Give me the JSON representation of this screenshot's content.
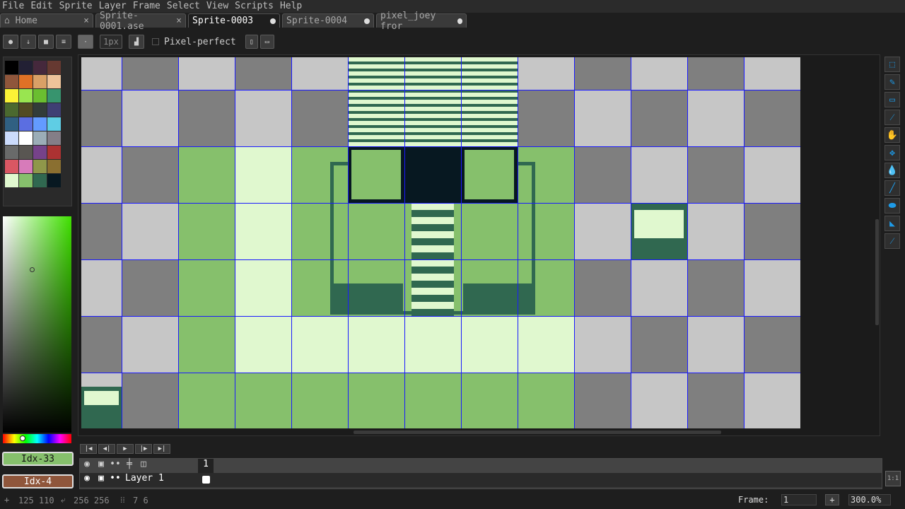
{
  "menu": [
    "File",
    "Edit",
    "Sprite",
    "Layer",
    "Frame",
    "Select",
    "View",
    "Scripts",
    "Help"
  ],
  "tabs": [
    {
      "label": "Home",
      "icon": "home-icon",
      "close": "×"
    },
    {
      "label": "Sprite-0001.ase",
      "close": "×"
    },
    {
      "label": "Sprite-0003",
      "active": true,
      "modified": true
    },
    {
      "label": "Sprite-0004",
      "modified": true
    },
    {
      "label": "pixel_joey fror",
      "modified": true
    }
  ],
  "toolbar": {
    "brush_size": "1px",
    "pixel_perfect_label": "Pixel-perfect",
    "pixel_perfect_checked": false
  },
  "palette": [
    "#000000",
    "#222034",
    "#45283c",
    "#663931",
    "#8f563b",
    "#df7126",
    "#d9a066",
    "#eec39a",
    "#fbf236",
    "#99e550",
    "#6abe30",
    "#37946e",
    "#4b692f",
    "#524b24",
    "#323c39",
    "#3f3f74",
    "#306082",
    "#5b6ee1",
    "#639bff",
    "#5fcde4",
    "#cbdbfc",
    "#ffffff",
    "#9badb7",
    "#847e87",
    "#696a6a",
    "#595652",
    "#76428a",
    "#ac3232",
    "#d95763",
    "#d77bba",
    "#8f974a",
    "#8a6f30",
    "#e0f8cf",
    "#86c06c",
    "#306850",
    "#071821"
  ],
  "foreground": {
    "label": "Idx-33",
    "color": "#86c06c"
  },
  "background": {
    "label": "Idx-4",
    "color": "#8f563b"
  },
  "right_tools": [
    "rectangular-marquee-icon",
    "pencil-icon",
    "eraser-icon",
    "eyedropper-icon",
    "hand-icon",
    "move-icon",
    "paint-bucket-icon",
    "line-icon",
    "ellipse-icon",
    "contour-icon",
    "spray-icon"
  ],
  "timeline": {
    "frame_header": "1",
    "layer_name": "Layer 1",
    "one_to_one": "1:1"
  },
  "status": {
    "cursor": "125 110",
    "size": "256 256",
    "grid": "7 6",
    "frame_label": "Frame:",
    "frame_value": "1",
    "zoom": "300.0%"
  }
}
